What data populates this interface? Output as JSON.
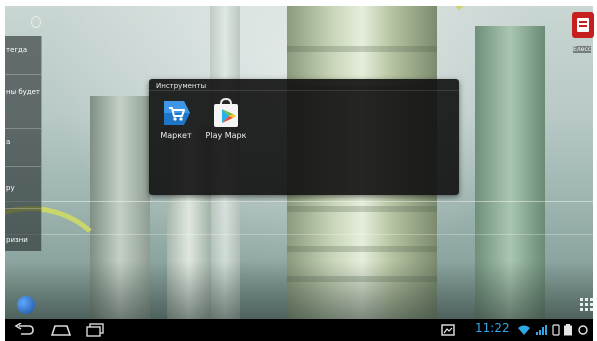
{
  "folder": {
    "title": "Инструменты",
    "apps": [
      {
        "label": "Маркет",
        "icon": "market-icon"
      },
      {
        "label": "Play Марк",
        "icon": "play-store-icon"
      }
    ]
  },
  "left_drawer": {
    "items": [
      "тегда",
      "ны будет",
      "а",
      "ру",
      "ризни"
    ]
  },
  "corner_app": {
    "label": "Елесс"
  },
  "status_bar": {
    "time": "11:22"
  },
  "colors": {
    "clock": "#2fa6e6",
    "folder_bg": "#0f0f0f",
    "market_blue": "#1f76c8",
    "corner_red": "#c61f1f"
  }
}
